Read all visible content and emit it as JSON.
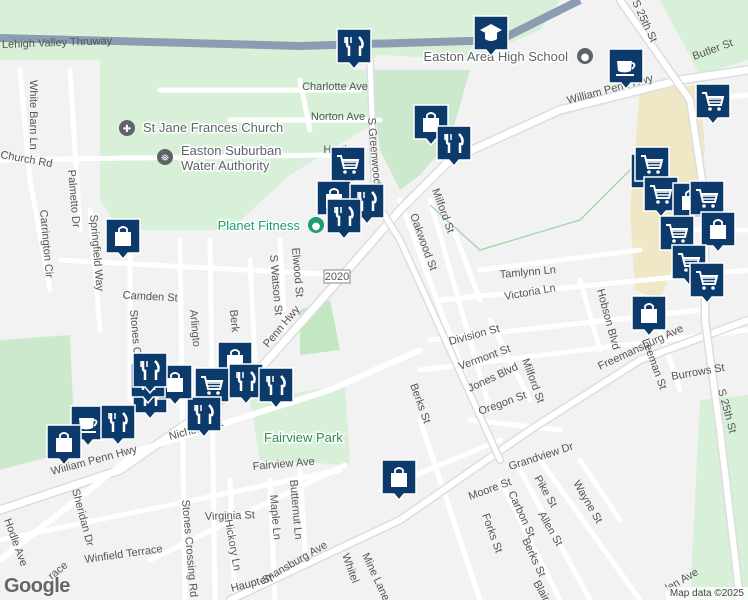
{
  "colors": {
    "background": "#f2f2f2",
    "park": "#c9ecc9",
    "road": "#ffffff",
    "highway": "#8c9db3",
    "road_outline": "#dcdcdc",
    "water_line": "#a7d8b0",
    "commercial": "#efe7c6",
    "marker": "#0c3a6b",
    "marker_border": "#ffffff",
    "poi_green": "#1e9e6e",
    "poi_gray": "#5f6368",
    "poi_label_green": "#2e8b57"
  },
  "roads": [
    {
      "name": "Lehigh Valley Thruway",
      "type": "highway"
    },
    {
      "name": "William Penn Hwy",
      "type": "major"
    },
    {
      "name": "Freemansburg Ave",
      "type": "major"
    },
    {
      "name": "S 25th St",
      "type": "major"
    },
    {
      "name": "Stones Crossing Rd",
      "type": "minor"
    },
    {
      "name": "S Greenwood",
      "type": "minor"
    }
  ],
  "street_labels": [
    "Lehigh Valley Thruway",
    "Charlotte Ave",
    "Norton Ave",
    "Hartl",
    "White Barn Ln",
    "Church Rd",
    "Palmetto Dr",
    "Carrington Cir",
    "Springfield Way",
    "Camden St",
    "S Watson St",
    "Elwood St",
    "Penn Hwy",
    "Stones C",
    "Arlingto",
    "Berk",
    "Nicholas St",
    "William Penn Hwy",
    "Sheridan Dr",
    "Hodle Ave",
    "Fairview Ave",
    "Virginia St",
    "Maple Ln",
    "Butternut Ln",
    "Hickory Ln",
    "Stones Crossing Rd",
    "Winfield Terrace",
    "race",
    "Haupt St",
    "emansburg Ave",
    "Whitel",
    "Mine Lane R",
    "Berks St",
    "Oregon St",
    "Jones Blvd",
    "Vermont St",
    "Division St",
    "Milford St",
    "Oakwood St",
    "Milford St",
    "Tamlynn Ln",
    "Victoria Ln",
    "Hobson Blvd",
    "Freemansburg Ave",
    "Leeman St",
    "Burrows St",
    "S 25th St",
    "Moore St",
    "Grandview Dr",
    "Pike St",
    "Carbon St",
    "Forks St",
    "Allen St",
    "Berks St",
    "Wayne St",
    "Blair",
    "len Ave",
    "S 25th St",
    "Butler St",
    "William Penn Hwy",
    "S Greenwood"
  ],
  "route_shield": "2020",
  "pois": [
    {
      "label": "St Jane Frances Church",
      "icon": "cross-icon"
    },
    {
      "label": "Easton Suburban\nWater Authority",
      "icon": "info-icon"
    },
    {
      "label": "Planet Fitness",
      "icon": "fitness-icon"
    },
    {
      "label": "Easton Area High School",
      "icon": "school-icon"
    },
    {
      "label": "Fairview Park",
      "icon": "park-icon"
    }
  ],
  "markers": [
    {
      "icon": "fork-knife-icon"
    },
    {
      "icon": "graduation-cap-icon"
    },
    {
      "icon": "coffee-cup-icon"
    },
    {
      "icon": "shopping-bag-icon"
    },
    {
      "icon": "fork-knife-icon"
    },
    {
      "icon": "shopping-cart-icon"
    },
    {
      "icon": "shopping-cart-icon"
    },
    {
      "icon": "shopping-bag-icon"
    },
    {
      "icon": "fork-knife-icon"
    },
    {
      "icon": "fork-knife-icon"
    },
    {
      "icon": "shopping-bag-icon"
    },
    {
      "icon": "shopping-cart-icon"
    },
    {
      "icon": "shopping-cart-icon"
    },
    {
      "icon": "shopping-bag-icon"
    },
    {
      "icon": "shopping-cart-icon"
    },
    {
      "icon": "shopping-bag-icon"
    },
    {
      "icon": "shopping-cart-icon"
    },
    {
      "icon": "shopping-cart-icon"
    },
    {
      "icon": "shopping-cart-icon"
    },
    {
      "icon": "shopping-bag-icon"
    },
    {
      "icon": "shopping-bag-icon"
    },
    {
      "icon": "shopping-bag-icon"
    },
    {
      "icon": "shopping-cart-icon"
    },
    {
      "icon": "fork-knife-icon"
    },
    {
      "icon": "fork-knife-icon"
    },
    {
      "icon": "fork-knife-icon"
    },
    {
      "icon": "fork-knife-icon"
    },
    {
      "icon": "shopping-bag-icon"
    },
    {
      "icon": "coffee-cup-icon"
    },
    {
      "icon": "fork-knife-icon"
    },
    {
      "icon": "fork-knife-icon"
    },
    {
      "icon": "fork-knife-icon"
    },
    {
      "icon": "shopping-bag-icon"
    },
    {
      "icon": "shopping-bag-icon"
    }
  ],
  "attribution": "Map data ©2025",
  "logo": "Google"
}
